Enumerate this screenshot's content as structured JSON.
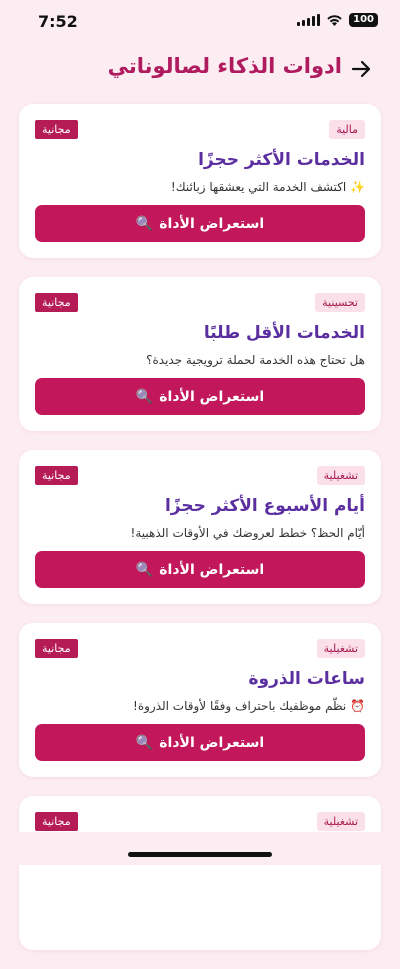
{
  "status": {
    "time": "7:52",
    "battery": "100"
  },
  "header": {
    "title": "ادوات الذكاء لصالوناتي",
    "back_icon": "arrow-right-icon"
  },
  "colors": {
    "accent": "#c2185b",
    "title": "#5b2fa0",
    "background": "#fcedf2"
  },
  "cards": [
    {
      "category": "مالية",
      "price": "مجانية",
      "title": "الخدمات الأكثر حجزًا",
      "description": "✨ اكتشف الخدمة التي يعشقها زبائنك!",
      "button": "استعراض الأداة",
      "button_icon": "🔍"
    },
    {
      "category": "تحسينية",
      "price": "مجانية",
      "title": "الخدمات الأقل طلبًا",
      "description": "هل تحتاج هذه الخدمة لحملة ترويجية جديدة؟",
      "button": "استعراض الأداة",
      "button_icon": "🔍"
    },
    {
      "category": "تشغيلية",
      "price": "مجانية",
      "title": "أيام الأسبوع الأكثر حجزًا",
      "description": "أيّام الحظ؟ خطط لعروضك في الأوقات الذهبية!",
      "button": "استعراض الأداة",
      "button_icon": "🔍"
    },
    {
      "category": "تشغيلية",
      "price": "مجانية",
      "title": "ساعات الذروة",
      "description": "⏰ نظّم موظفيك باحتراف وفقًا لأوقات الذروة!",
      "button": "استعراض الأداة",
      "button_icon": "🔍"
    },
    {
      "category": "تشغيلية",
      "price": "مجانية",
      "title": "",
      "description": "",
      "button": "",
      "button_icon": ""
    }
  ]
}
